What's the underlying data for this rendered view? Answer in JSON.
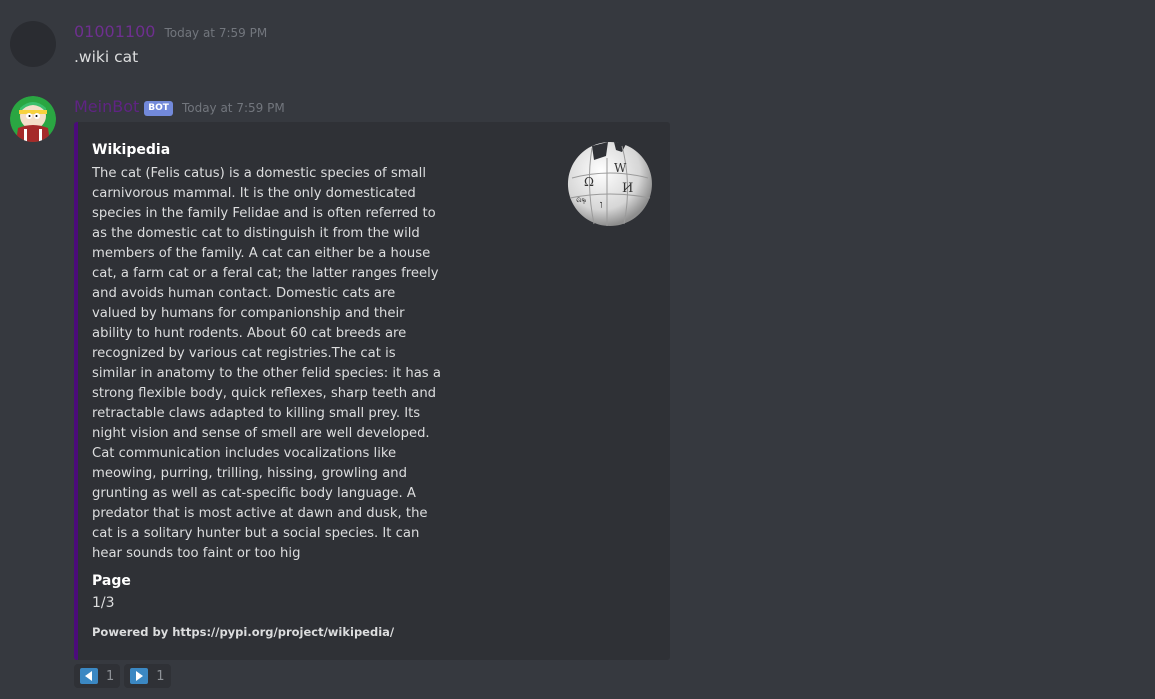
{
  "messages": [
    {
      "username": "01001100",
      "username_color": "#6e2f8f",
      "timestamp": "Today at 7:59 PM",
      "content": ".wiki cat"
    },
    {
      "username": "MeinBot",
      "username_color": "#5f2483",
      "bot_tag": "BOT",
      "timestamp": "Today at 7:59 PM",
      "embed": {
        "border_color": "#4b0c7a",
        "author": "Wikipedia",
        "description": "The cat (Felis catus) is a domestic species of small carnivorous mammal. It is the only domesticated species in the family Felidae and is often referred to as the domestic cat to distinguish it from the wild members of the family. A cat can either be a house cat, a farm cat or a feral cat; the latter ranges freely and avoids human contact. Domestic cats are valued by humans for companionship and their ability to hunt rodents. About 60 cat breeds are recognized by various cat registries.The cat is similar in anatomy to the other felid species: it has a strong flexible body, quick reflexes, sharp teeth and retractable claws adapted to killing small prey. Its night vision and sense of smell are well developed. Cat communication includes vocalizations like meowing, purring, trilling, hissing, growling and grunting as well as cat-specific body language. A predator that is most active at dawn and dusk, the cat is a solitary hunter but a social species. It can hear sounds too faint or too hig",
        "field_name": "Page",
        "field_value": "1/3",
        "footer": "Powered by https://pypi.org/project/wikipedia/",
        "thumbnail_icon": "wikipedia-globe-icon"
      },
      "reactions": [
        {
          "icon": "arrow-left-icon",
          "count": "1"
        },
        {
          "icon": "arrow-right-icon",
          "count": "1"
        }
      ]
    }
  ]
}
